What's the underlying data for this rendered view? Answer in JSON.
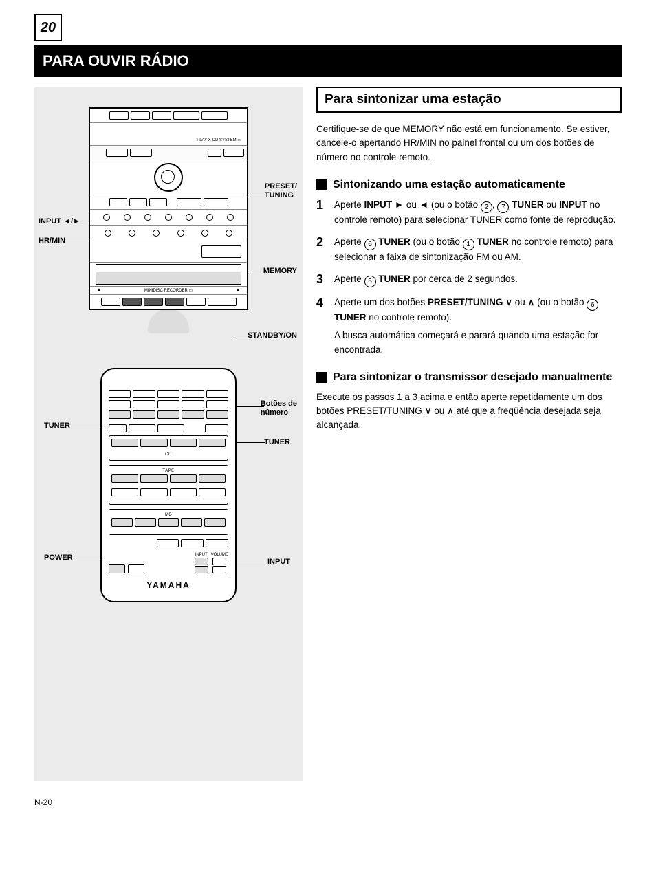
{
  "page_number": "N-20",
  "page_number_display": "20",
  "title": "PARA OUVIR RÁDIO",
  "left": {
    "main_unit": {
      "callouts": {
        "input_left_right": "INPUT ◄/►",
        "preset_tuning_box": "PRESET/\nTUNING",
        "memory": "MEMORY",
        "hr_min": "HR/MIN",
        "standby_on": "STANDBY/ON"
      }
    },
    "remote": {
      "brand": "YAMAHA",
      "callouts": {
        "numbers": "Botões de\nnúmero",
        "tuner_top": "TUNER",
        "tuner_side": "TUNER",
        "power": "POWER",
        "input_up_down": "INPUT"
      }
    }
  },
  "section_title": "Para sintonizar uma estação",
  "intro": "Certifique-se de que MEMORY não está em funcionamento. Se estiver, cancele-o apertando HR/MIN no painel frontal ou um dos botões de número no controle remoto.",
  "sub1_title": "Sintonizando uma estação automaticamente",
  "sub1_steps": {
    "s1": {
      "pre": "Aperte ",
      "bold1": "INPUT ",
      "arr_r": "►",
      "or1": " ou ",
      "arr_l": "◄",
      "post1": " (ou o botão ",
      "c1": "2",
      "space1": ", ",
      "c2": "7",
      "bold2": " TUNER",
      "post2": " ou ",
      "bold3": "INPUT",
      "post3": " no controle remoto) para selecionar TUNER como fonte de reprodução."
    },
    "s2": {
      "t1": "Aperte ",
      "c6": "6",
      "bold1": " TUNER",
      "t2": " (ou o botão ",
      "c1": "1",
      "bold2": " TUNER",
      "t3": " no controle remoto) para selecionar a faixa de sintonização FM ou AM."
    },
    "s3": {
      "t1": "Aperte ",
      "c6": "6",
      "bold": " TUNER",
      "t2": " por cerca de 2 segundos."
    },
    "s4": {
      "t1": "Aperte um dos botões ",
      "bold": "PRESET/TUNING ",
      "down": "∨",
      "t2": " ou ",
      "up": "∧",
      "t3": " (ou o botão ",
      "c6": "6",
      "bold2": " TUNER",
      "t4": " no controle remoto)."
    },
    "s4_cont": "A busca automática começará e parará quando uma estação for encontrada."
  },
  "sub2_title": "Para sintonizar o transmissor desejado manualmente",
  "sub2_body": {
    "t1": "Execute os passos 1 a 3 acima e então aperte repetidamente um dos botões ",
    "bold": "PRESET/TUNING ",
    "d": "∨",
    "t2": " ou ",
    "u": "∧",
    "t3": " até que a freqüência desejada seja alcançada."
  }
}
